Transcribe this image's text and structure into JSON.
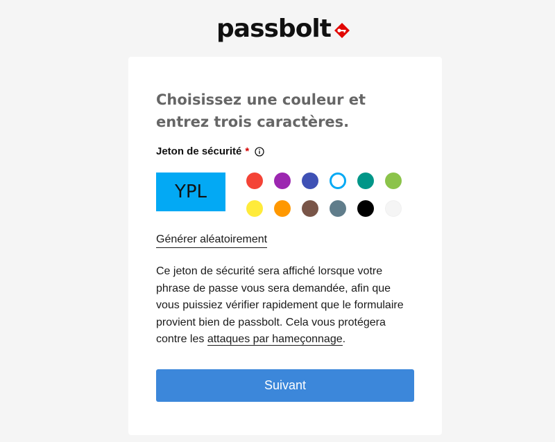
{
  "logo": {
    "text": "passbolt",
    "mark_color": "#e10600"
  },
  "form": {
    "title": "Choisissez une couleur et entrez trois caractères.",
    "token_label": "Jeton de sécurité",
    "required_mark": "*",
    "info_icon": "info-circle-icon",
    "token_value": "YPL",
    "token_color": "#03a9f4",
    "colors": [
      {
        "name": "red",
        "hex": "#f44336",
        "selected": false
      },
      {
        "name": "purple",
        "hex": "#9c27b0",
        "selected": false
      },
      {
        "name": "indigo",
        "hex": "#3f51b5",
        "selected": false
      },
      {
        "name": "light-blue",
        "hex": "#03a9f4",
        "selected": true
      },
      {
        "name": "teal",
        "hex": "#009688",
        "selected": false
      },
      {
        "name": "light-green",
        "hex": "#8bc34a",
        "selected": false
      },
      {
        "name": "yellow",
        "hex": "#ffeb3b",
        "selected": false
      },
      {
        "name": "orange",
        "hex": "#ff9800",
        "selected": false
      },
      {
        "name": "brown",
        "hex": "#795548",
        "selected": false
      },
      {
        "name": "blue-grey",
        "hex": "#607d8b",
        "selected": false
      },
      {
        "name": "black",
        "hex": "#000000",
        "selected": false
      },
      {
        "name": "white",
        "hex": "#f5f5f5",
        "selected": false
      }
    ],
    "generate_link": "Générer aléatoirement",
    "help_text_before": "Ce jeton de sécurité sera affiché lorsque votre phrase de passe vous sera demandée, afin que vous puissiez vérifier rapidement que le formulaire provient bien de passbolt. Cela vous protégera contre les ",
    "help_link": "attaques par hameçonnage",
    "help_text_after": ".",
    "next_button": "Suivant",
    "button_color": "#3c87da"
  }
}
